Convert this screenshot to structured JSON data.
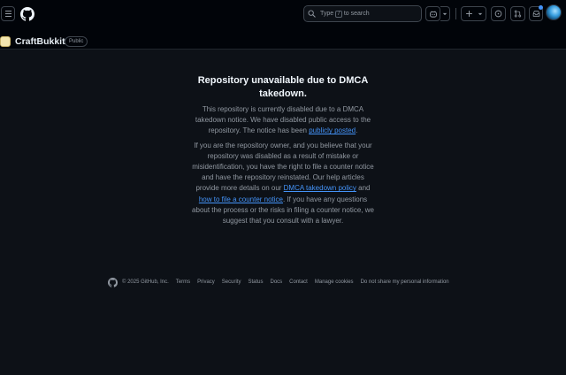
{
  "header": {
    "search_prefix": "Type",
    "search_key": "/",
    "search_suffix": "to search"
  },
  "repo": {
    "name": "CraftBukkit",
    "visibility": "Public"
  },
  "notice": {
    "title": "Repository unavailable due to DMCA takedown.",
    "p1_text": "This repository is currently disabled due to a DMCA takedown notice. We have disabled public access to the repository. The notice has been ",
    "p1_link": "publicly posted",
    "p1_end": ".",
    "p2_text": "If you are the repository owner, and you believe that your repository was disabled as a result of mistake or misidentification, you have the right to file a counter notice and have the repository reinstated. Our help articles provide more details on our ",
    "p2_link1": "DMCA takedown policy",
    "p2_mid": " and ",
    "p2_link2": "how to file a counter notice",
    "p2_end": ". If you have any questions about the process or the risks in filing a counter notice, we suggest that you consult with a lawyer."
  },
  "footer": {
    "copyright": "© 2025 GitHub, Inc.",
    "links": [
      "Terms",
      "Privacy",
      "Security",
      "Status",
      "Docs",
      "Contact",
      "Manage cookies",
      "Do not share my personal information"
    ]
  },
  "colors": {
    "background": "#0d1117",
    "header_bg": "#010409",
    "link": "#4493f8",
    "notification_dot": "#4493f8"
  },
  "icons": [
    "hamburger-icon",
    "github-logo-icon",
    "search-icon",
    "copilot-icon",
    "chevron-down-icon",
    "plus-icon",
    "issues-icon",
    "pull-requests-icon",
    "inbox-icon",
    "avatar"
  ]
}
